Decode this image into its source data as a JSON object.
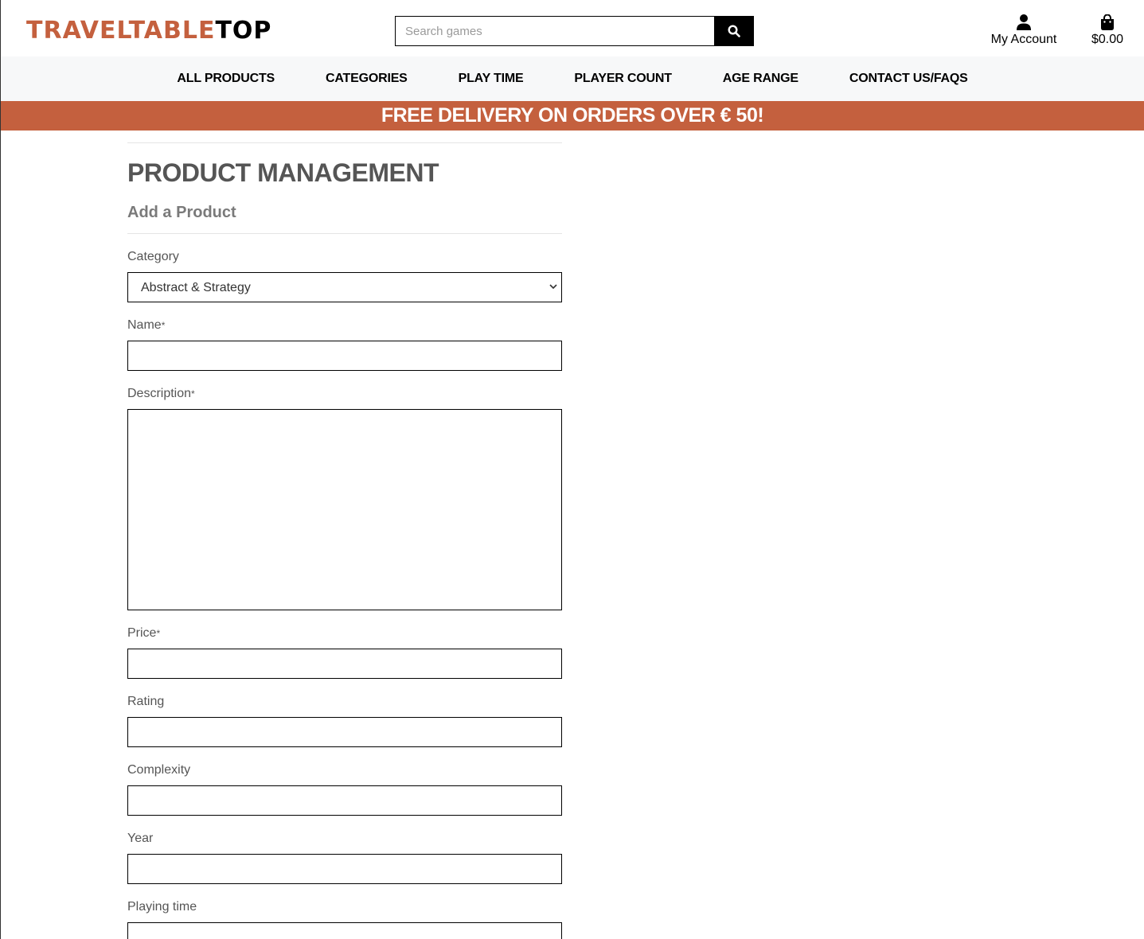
{
  "header": {
    "logo_part1": "TRAVELTABLE",
    "logo_part2": "TOP",
    "search_placeholder": "Search games",
    "account_label": "My Account",
    "bag_total": "$0.00"
  },
  "nav": {
    "items": [
      {
        "label": "ALL PRODUCTS"
      },
      {
        "label": "CATEGORIES"
      },
      {
        "label": "PLAY TIME"
      },
      {
        "label": "PLAYER COUNT"
      },
      {
        "label": "AGE RANGE"
      },
      {
        "label": "CONTACT US/FAQS"
      }
    ]
  },
  "banner": {
    "text": "FREE DELIVERY ON ORDERS OVER € 50!"
  },
  "page": {
    "title": "PRODUCT MANAGEMENT",
    "subtitle": "Add a Product"
  },
  "form": {
    "category": {
      "label": "Category",
      "selected": "Abstract & Strategy"
    },
    "name": {
      "label": "Name",
      "required": "*",
      "value": ""
    },
    "description": {
      "label": "Description",
      "required": "*",
      "value": ""
    },
    "price": {
      "label": "Price",
      "required": "*",
      "value": ""
    },
    "rating": {
      "label": "Rating",
      "value": ""
    },
    "complexity": {
      "label": "Complexity",
      "value": ""
    },
    "year": {
      "label": "Year",
      "value": ""
    },
    "playing_time": {
      "label": "Playing time",
      "value": ""
    }
  },
  "colors": {
    "brand": "#c4603e",
    "nav_bg": "#f7f8f9",
    "text": "#555555"
  },
  "icons": {
    "search": "search-icon",
    "account": "user-icon",
    "bag": "shopping-bag-icon",
    "select": "chevron-down-icon"
  }
}
